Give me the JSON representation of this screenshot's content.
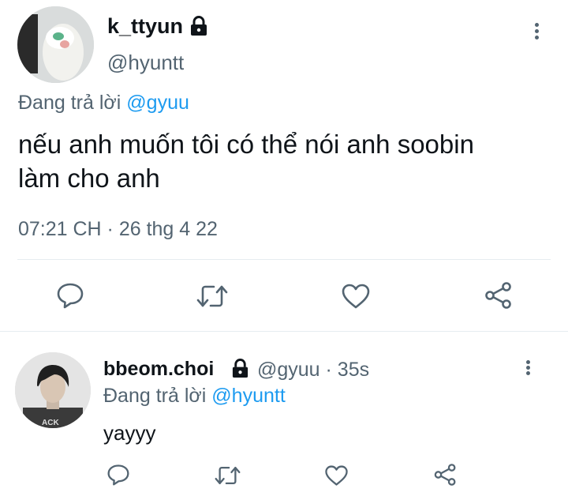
{
  "main_tweet": {
    "display_name": "k_ttyun",
    "handle": "@hyuntt",
    "replying_prefix": "Đang trả lời",
    "replying_to": "@gyuu",
    "text_line1": "nếu anh muốn tôi có thể nói anh soobin",
    "text_line2": "làm cho anh",
    "timestamp": "07:21 CH · 26 thg 4 22"
  },
  "reply_tweet": {
    "display_name": "bbeom.choi",
    "handle_time": "@gyuu · 35s",
    "replying_prefix": "Đang trả lời",
    "replying_to": "@hyuntt",
    "text": "yayyy"
  },
  "icons": [
    "lock-icon",
    "more-icon",
    "reply-icon",
    "retweet-icon",
    "like-icon",
    "share-icon"
  ],
  "colors": {
    "link": "#1d9bf0",
    "secondary": "#536471",
    "text": "#0f1419"
  }
}
